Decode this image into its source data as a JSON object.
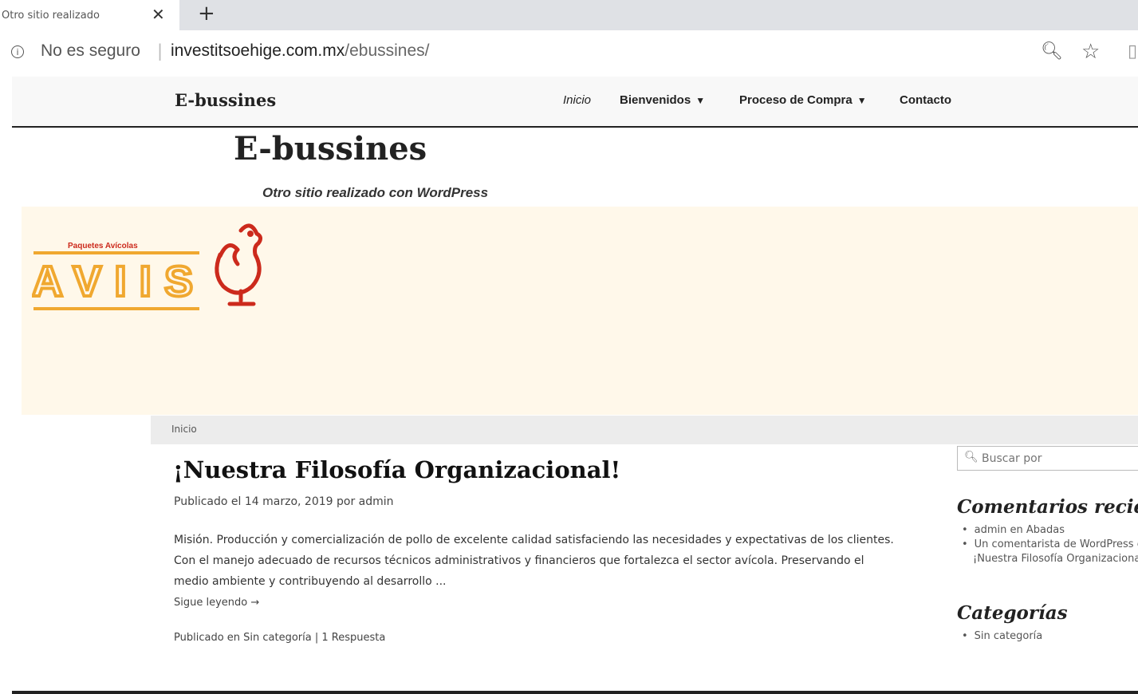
{
  "browser": {
    "tab_title": "Otro sitio realizado",
    "tab_close": "✕",
    "new_tab": "+",
    "security_text": "No es seguro",
    "url_host": "investitsoehige.com.mx",
    "url_path": "/ebussines/"
  },
  "nav": {
    "brand": "E-bussines",
    "items": [
      {
        "label": "Inicio"
      },
      {
        "label": "Bienvenidos"
      },
      {
        "label": "Proceso de Compra"
      },
      {
        "label": "Contacto"
      }
    ]
  },
  "header": {
    "site_title": "E-bussines",
    "site_description": "Otro sitio realizado con WordPress"
  },
  "banner": {
    "logo_tagline": "Paquetes Avícolas",
    "logo_text": "AVIIS",
    "colors": {
      "background": "#fff8ea",
      "logo_orange": "#f0a830",
      "logo_red": "#cc2a1c"
    }
  },
  "breadcrumb": "Inicio",
  "post": {
    "title": "¡Nuestra Filosofía Organizacional!",
    "meta": "Publicado el 14 marzo, 2019 por admin",
    "excerpt": "Misión.   Producción y comercialización de pollo de excelente calidad satisfaciendo las necesidades y expectativas de los clientes. Con el manejo adecuado de recursos técnicos administrativos y financieros que fortalezca el sector avícola. Preservando el medio ambiente y contribuyendo al desarrollo ...",
    "more_link": "Sigue leyendo →",
    "footer": "Publicado en Sin categoría | 1 Respuesta"
  },
  "sidebar": {
    "search_placeholder": "Buscar por",
    "recent_comments_title": "Comentarios recientes",
    "recent_comments": [
      "admin en Abadas",
      "Un comentarista de WordPress en"
    ],
    "recent_comments_cont": "¡Nuestra Filosofía Organizacional!",
    "categories_title": "Categorías",
    "categories": [
      "Sin categoría"
    ]
  }
}
